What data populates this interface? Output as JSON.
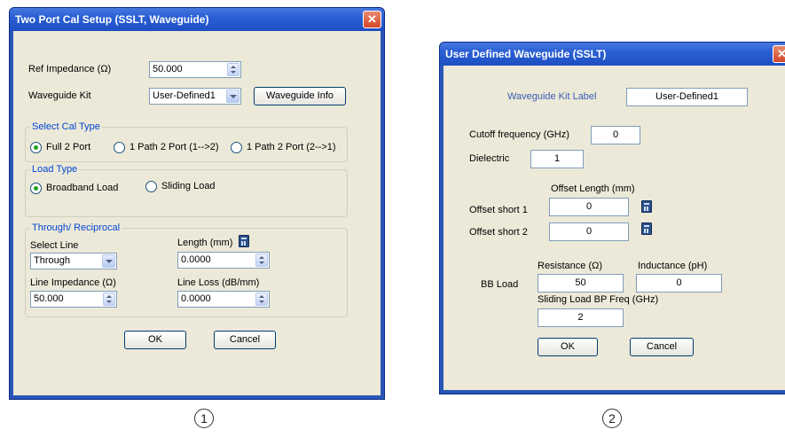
{
  "dialog1": {
    "title": "Two Port Cal Setup (SSLT, Waveguide)",
    "close_glyph": "✕",
    "ref_impedance": {
      "label": "Ref Impedance (Ω)",
      "value": "50.000"
    },
    "waveguide_kit": {
      "label": "Waveguide  Kit",
      "value": "User-Defined1",
      "info_button": "Waveguide Info"
    },
    "cal_type": {
      "group_label": "Select Cal Type",
      "options": [
        "Full 2 Port",
        "1 Path 2 Port (1-->2)",
        "1 Path 2 Port (2-->1)"
      ],
      "selected": "Full 2 Port"
    },
    "load_type": {
      "group_label": "Load Type",
      "options": [
        "Broadband Load",
        "Sliding Load"
      ],
      "selected": "Broadband Load"
    },
    "through": {
      "group_label": "Through/ Reciprocal",
      "select_line_label": "Select Line",
      "select_line_value": "Through",
      "length_label": "Length (mm)",
      "length_value": "0.0000",
      "line_impedance_label": "Line Impedance (Ω)",
      "line_impedance_value": "50.000",
      "line_loss_label": "Line Loss (dB/mm)",
      "line_loss_value": "0.0000"
    },
    "ok_label": "OK",
    "cancel_label": "Cancel",
    "callout": "1"
  },
  "dialog2": {
    "title": "User Defined Waveguide (SSLT)",
    "close_glyph": "✕",
    "kit_label": {
      "label": "Waveguide Kit Label",
      "value": "User-Defined1"
    },
    "cutoff": {
      "label": "Cutoff frequency (GHz)",
      "value": "0"
    },
    "dielectric": {
      "label": "Dielectric",
      "value": "1"
    },
    "offset_length_header": "Offset Length (mm)",
    "offset_short1": {
      "label": "Offset short 1",
      "value": "0"
    },
    "offset_short2": {
      "label": "Offset short 2",
      "value": "0"
    },
    "bb_load": {
      "label": "BB Load",
      "resistance_label": "Resistance (Ω)",
      "resistance_value": "50",
      "inductance_label": "Inductance (pH)",
      "inductance_value": "0"
    },
    "sliding_load": {
      "label": "Sliding Load BP Freq (GHz)",
      "value": "2"
    },
    "ok_label": "OK",
    "cancel_label": "Cancel",
    "callout": "2"
  },
  "colors": {
    "titlebar": "#2a5fd4",
    "client": "#ece9d8",
    "group_title": "#0046d5",
    "radio_dot": "#21a121"
  },
  "icons": [
    "close-icon",
    "calculator-icon",
    "spin-arrows-icon",
    "dropdown-arrow-icon"
  ]
}
